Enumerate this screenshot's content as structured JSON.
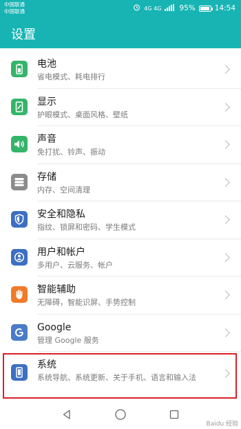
{
  "status": {
    "carrier_line1": "中国联通",
    "carrier_line2": "中国联通",
    "net_labels": "4G 4G",
    "battery_percent_text": "95%",
    "battery_level": 0.95,
    "time": "14:54"
  },
  "header": {
    "title": "设置"
  },
  "settings": [
    {
      "title": "电池",
      "subtitle": "省电模式、耗电排行",
      "icon": "battery-icon",
      "color": "#35b46a"
    },
    {
      "title": "显示",
      "subtitle": "护眼模式、桌面风格、壁纸",
      "icon": "display-icon",
      "color": "#35b46a"
    },
    {
      "title": "声音",
      "subtitle": "免打扰、铃声、振动",
      "icon": "sound-icon",
      "color": "#35b46a"
    },
    {
      "title": "存储",
      "subtitle": "内存、空间清理",
      "icon": "storage-icon",
      "color": "#8c8c8c"
    },
    {
      "title": "安全和隐私",
      "subtitle": "指纹、锁屏和密码、学生模式",
      "icon": "shield-icon",
      "color": "#3d6fc2"
    },
    {
      "title": "用户和帐户",
      "subtitle": "多用户、云服务、帐户",
      "icon": "user-icon",
      "color": "#3d6fc2"
    },
    {
      "title": "智能辅助",
      "subtitle": "无障碍，智能识屏、手势控制",
      "icon": "hand-icon",
      "color": "#f07a2a"
    },
    {
      "title": "Google",
      "subtitle": "管理 Google 服务",
      "icon": "google-icon",
      "color": "#4a7cc8"
    },
    {
      "title": "系统",
      "subtitle": "系统导航、系统更新、关于手机、语言和输入法",
      "icon": "phone-icon",
      "color": "#3d6fc2"
    }
  ],
  "navbar": {
    "back": "back-icon",
    "home": "home-icon",
    "recents": "recents-icon"
  },
  "watermark": "Baidu 经验"
}
